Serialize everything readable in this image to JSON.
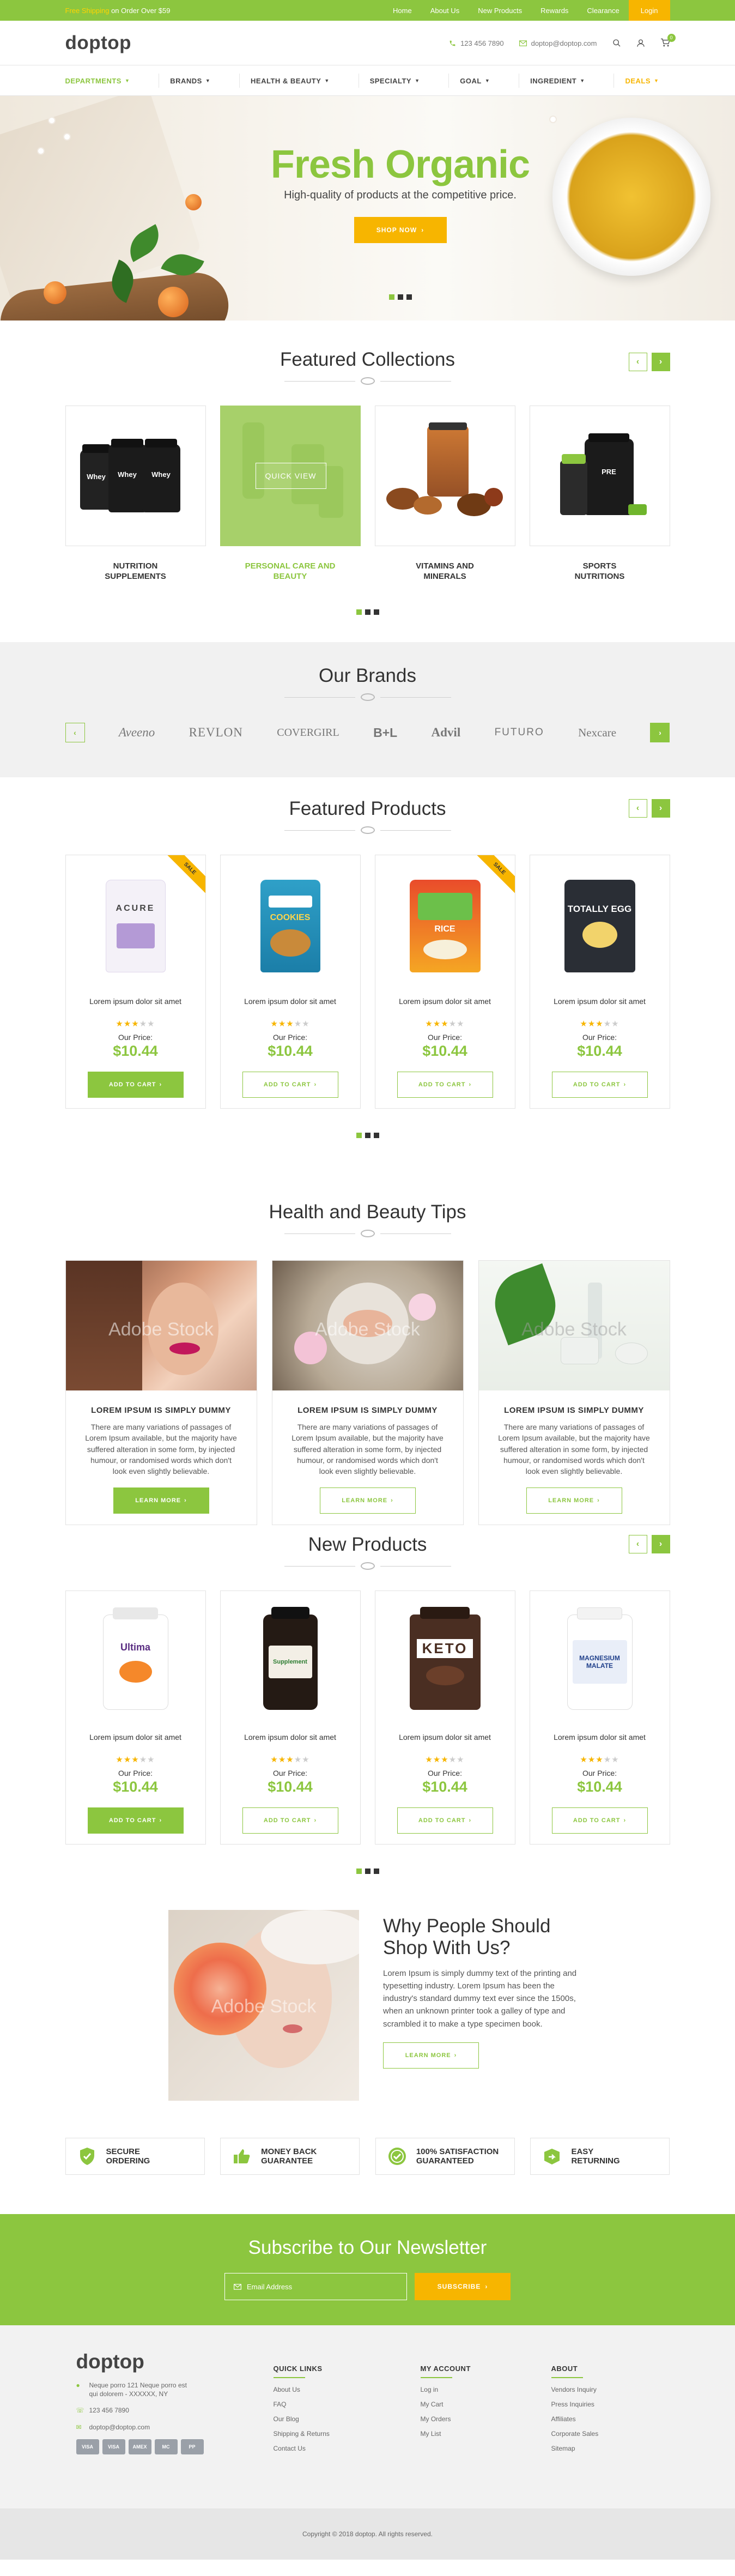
{
  "topbar": {
    "promo_highlight": "Free Shipping",
    "promo_rest": " on Order Over $59",
    "links": [
      "Home",
      "About Us",
      "New Products",
      "Rewards",
      "Clearance"
    ],
    "login": "Login"
  },
  "header": {
    "logo": "doptop",
    "phone": "123 456 7890",
    "email": "doptop@doptop.com",
    "cart_count": "0"
  },
  "nav": {
    "items": [
      "Departments",
      "Brands",
      "Health & Beauty",
      "Specialty",
      "Goal",
      "Ingredient",
      "Deals"
    ]
  },
  "hero": {
    "title": "Fresh Organic",
    "subtitle": "High-quality of products at the competitive price.",
    "cta": "Shop Now"
  },
  "collections": {
    "title": "Featured Collections",
    "quick_view": "Quick View",
    "items": [
      {
        "line1": "Nutrition",
        "line2": "Supplements"
      },
      {
        "line1": "Personal Care and",
        "line2": "Beauty"
      },
      {
        "line1": "Vitamins and",
        "line2": "Minerals"
      },
      {
        "line1": "Sports",
        "line2": "Nutritions"
      }
    ]
  },
  "brands": {
    "title": "Our Brands",
    "items": [
      "Aveeno",
      "REVLON",
      "COVERGIRL",
      "B+L",
      "Advil",
      "FUTURO",
      "Nexcare"
    ]
  },
  "featured_products": {
    "title": "Featured Products",
    "items": [
      {
        "name": "Lorem ipsum dolor sit amet",
        "price_label": "Our Price:",
        "price": "$10.44",
        "cta": "Add to Cart",
        "badge": "Sale",
        "brand_text": "ACURE"
      },
      {
        "name": "Lorem ipsum dolor sit amet",
        "price_label": "Our Price:",
        "price": "$10.44",
        "cta": "Add to Cart",
        "badge": "",
        "brand_text": "COOKIES"
      },
      {
        "name": "Lorem ipsum dolor sit amet",
        "price_label": "Our Price:",
        "price": "$10.44",
        "cta": "Add to Cart",
        "badge": "Sale",
        "brand_text": "RICE"
      },
      {
        "name": "Lorem ipsum dolor sit amet",
        "price_label": "Our Price:",
        "price": "$10.44",
        "cta": "Add to Cart",
        "badge": "",
        "brand_text": "TOTALLY EGG"
      }
    ]
  },
  "tips": {
    "title": "Health and Beauty Tips",
    "watermark": "Adobe Stock",
    "items": [
      {
        "title": "Lorem Ipsum Is Simply Dummy",
        "text": "There are many variations of passages of Lorem Ipsum available, but the majority have suffered alteration in some form, by injected humour, or randomised words which don't look even slightly believable.",
        "cta": "Learn More"
      },
      {
        "title": "Lorem Ipsum Is Simply Dummy",
        "text": "There are many variations of passages of Lorem Ipsum available, but the majority have suffered alteration in some form, by injected humour, or randomised words which don't look even slightly believable.",
        "cta": "Learn More"
      },
      {
        "title": "Lorem Ipsum Is Simply Dummy",
        "text": "There are many variations of passages of Lorem Ipsum available, but the majority have suffered alteration in some form, by injected humour, or randomised words which don't look even slightly believable.",
        "cta": "Learn More"
      }
    ]
  },
  "new_products": {
    "title": "New Products",
    "items": [
      {
        "name": "Lorem ipsum dolor sit amet",
        "price_label": "Our Price:",
        "price": "$10.44",
        "cta": "Add to Cart",
        "brand_text": "Ultima"
      },
      {
        "name": "Lorem ipsum dolor sit amet",
        "price_label": "Our Price:",
        "price": "$10.44",
        "cta": "Add to Cart",
        "brand_text": "Supplement"
      },
      {
        "name": "Lorem ipsum dolor sit amet",
        "price_label": "Our Price:",
        "price": "$10.44",
        "cta": "Add to Cart",
        "brand_text": "KETO"
      },
      {
        "name": "Lorem ipsum dolor sit amet",
        "price_label": "Our Price:",
        "price": "$10.44",
        "cta": "Add to Cart",
        "brand_text": "MAGNESIUM MALATE"
      }
    ]
  },
  "why": {
    "title": "Why People Should Shop With Us?",
    "text": "Lorem Ipsum is simply dummy text of the printing and typesetting industry. Lorem Ipsum has been the industry's standard dummy text ever since the 1500s, when an unknown printer took a galley of type and scrambled it to make a type specimen book.",
    "cta": "Learn More",
    "watermark": "Adobe Stock"
  },
  "features": [
    {
      "line1": "Secure",
      "line2": "Ordering"
    },
    {
      "line1": "Money Back",
      "line2": "Guarantee"
    },
    {
      "line1": "100% Satisfaction",
      "line2": "Guaranteed"
    },
    {
      "line1": "Easy",
      "line2": "Returning"
    }
  ],
  "newsletter": {
    "title": "Subscribe to Our Newsletter",
    "placeholder": "Email Address",
    "cta": "Subscribe"
  },
  "footer": {
    "logo": "doptop",
    "address": "Neque porro 121 Neque porro est qui dolorem - XXXXXX, NY",
    "phone": "123 456 7890",
    "email": "doptop@doptop.com",
    "cards": [
      "VISA",
      "VISA",
      "AMEX",
      "MC",
      "PP"
    ],
    "quick_links": {
      "title": "Quick Links",
      "items": [
        "About Us",
        "FAQ",
        "Our Blog",
        "Shipping & Returns",
        "Contact Us"
      ]
    },
    "my_account": {
      "title": "My Account",
      "items": [
        "Log in",
        "My Cart",
        "My Orders",
        "My List"
      ]
    },
    "about": {
      "title": "About",
      "items": [
        "Vendors Inquiry",
        "Press Inquiries",
        "Affiliates",
        "Corporate Sales",
        "Sitemap"
      ]
    },
    "copyright": "Copyright © 2018 doptop. All rights reserved."
  },
  "colors": {
    "accent": "#8cc63f",
    "cta": "#f7b500"
  }
}
